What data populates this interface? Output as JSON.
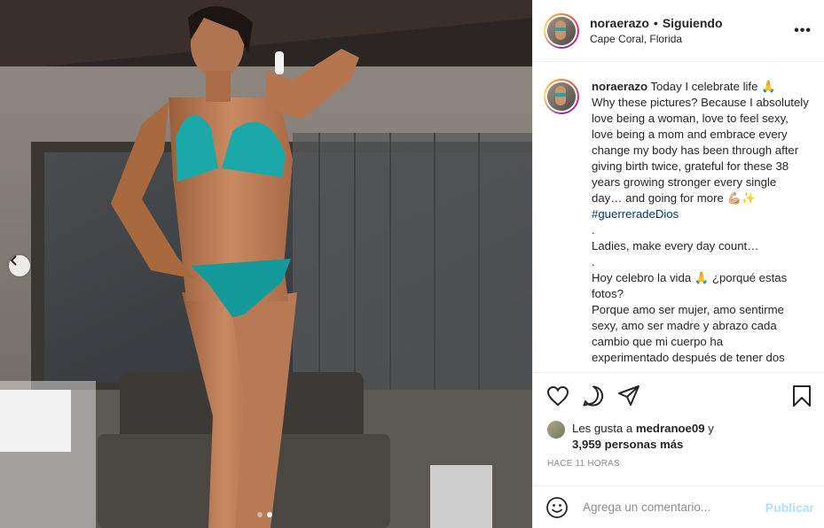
{
  "post": {
    "username": "noraerazo",
    "separator": "•",
    "follow_status": "Siguiendo",
    "location": "Cape Coral, Florida",
    "more_icon": "more-options-icon",
    "carousel": {
      "slides": 2,
      "active": 2
    }
  },
  "caption": {
    "username": "noraerazo",
    "line_1": "Today I celebrate life 🙏",
    "line_2": "Why these pictures? Because I absolutely",
    "line_3": "love being a woman, love to feel sexy,",
    "line_4": "love being a mom and embrace every",
    "line_5": "change my body has been through after",
    "line_6": "giving birth twice, grateful for these 38",
    "line_7": "years growing stronger every single",
    "line_8": "day… and going for more 💪🏼✨",
    "hashtag": "#guerreradeDios",
    "dot_1": ".",
    "line_9": "Ladies, make every day count…",
    "dot_2": ".",
    "line_10": "Hoy celebro la vida 🙏 ¿porqué estas",
    "line_11": "fotos?",
    "line_12": "Porque amo ser mujer, amo sentirme",
    "line_13": "sexy, amo ser madre y abrazo cada",
    "line_14": "cambio que mi cuerpo ha",
    "line_15": "experimentado después de tener dos"
  },
  "likes": {
    "prefix": "Les gusta a",
    "user": "medranoe09",
    "connector": "y",
    "count": "3,959 personas más"
  },
  "timestamp": "HACE 11 HORAS",
  "comment": {
    "placeholder": "Agrega un comentario...",
    "post_label": "Publicar"
  },
  "colors": {
    "link": "#00376b",
    "muted": "#8e8e8e",
    "post_disabled": "#b2dffc",
    "swimsuit": "#1aa9a8"
  }
}
